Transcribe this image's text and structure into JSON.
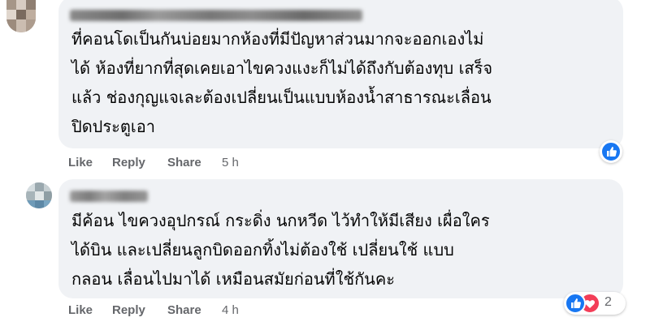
{
  "comments": [
    {
      "author_blurred": true,
      "lines": [
        "ที่คอนโดเป็นกันบ่อยมากห้องที่มีปัญหาส่วนมากจะออกเองไม่",
        "ได้ ห้องที่ยากที่สุดเคยเอาไขควงแงะก็ไม่ได้ถึงกับต้องทุบ เสร็จ",
        "แล้ว ช่องกุญแจเละต้องเปลี่ยนเป็นแบบห้องน้ำสาธารณะเลื่อน",
        "ปิดประตูเอา"
      ],
      "actions": {
        "like": "Like",
        "reply": "Reply",
        "share": "Share",
        "time": "5 h"
      },
      "reactions": {
        "types": [
          "like-icon"
        ],
        "count": ""
      }
    },
    {
      "author_blurred": true,
      "lines": [
        "มีค้อน ไขควงอุปกรณ์ กระดิ่ง นกหวีด ไว้ทำให้มีเสียง เผื่อใคร",
        "ได้บิน และเปลี่ยนลูกบิดออกทิ้งไม่ต้องใช้ เปลี่ยนใช้ แบบ",
        "กลอน เลื่อนไปมาได้ เหมือนสมัยก่อนที่ใช้กันคะ"
      ],
      "actions": {
        "like": "Like",
        "reply": "Reply",
        "share": "Share",
        "time": "4 h"
      },
      "reactions": {
        "types": [
          "like-icon",
          "love-icon"
        ],
        "count": "2"
      }
    }
  ],
  "colors": {
    "bubble": "#f0f2f5",
    "action_text": "#65676b",
    "like_blue": "#1877f2",
    "love_red": "#f33e58"
  }
}
